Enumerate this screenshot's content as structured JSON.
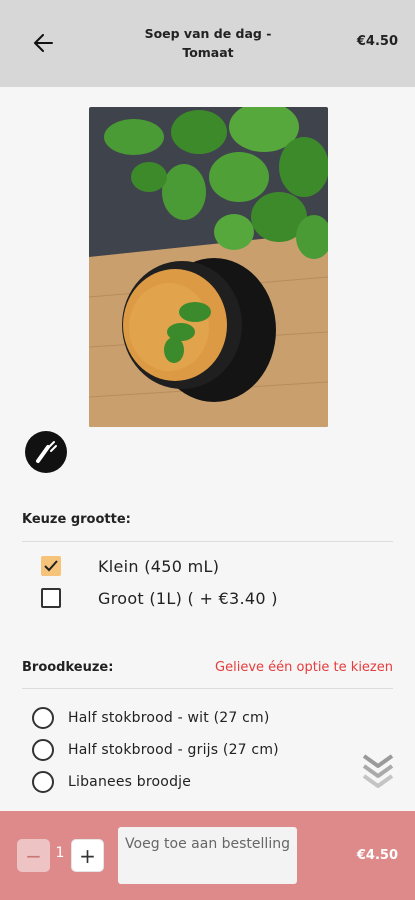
{
  "header": {
    "title": "Soep van de dag - Tomaat",
    "price": "€4.50"
  },
  "size_section": {
    "title": "Keuze grootte:",
    "options": [
      {
        "label": "Klein (450 mL)",
        "checked": true
      },
      {
        "label": "Groot (1L) ( + €3.40 )",
        "checked": false
      }
    ]
  },
  "bread_section": {
    "title": "Broodkeuze:",
    "warning": "Gelieve één optie te kiezen",
    "options": [
      {
        "label": "Half stokbrood - wit (27 cm)"
      },
      {
        "label": "Half stokbrood - grijs (27 cm)"
      },
      {
        "label": "Libanees broodje"
      }
    ]
  },
  "footer": {
    "quantity": "1",
    "minus": "−",
    "plus": "+",
    "add_label": "Voeg toe aan bestelling",
    "price": "€4.50"
  }
}
